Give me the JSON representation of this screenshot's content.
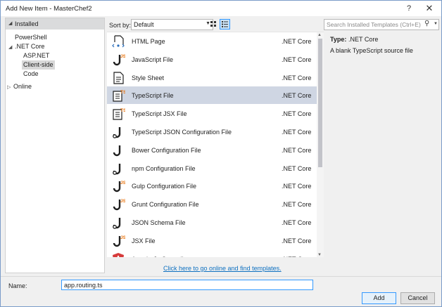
{
  "window": {
    "title": "Add New Item - MasterChef2",
    "help": "?",
    "close": "✕"
  },
  "tree": {
    "header": "Installed",
    "items": [
      {
        "label": "PowerShell",
        "expander": ""
      },
      {
        "label": ".NET Core",
        "expander": "◢"
      },
      {
        "label": "ASP.NET",
        "expander": ""
      },
      {
        "label": "Client-side",
        "expander": ""
      },
      {
        "label": "Code",
        "expander": ""
      },
      {
        "label": "Online",
        "expander": "▷"
      }
    ]
  },
  "toolbar": {
    "sort_label": "Sort by:",
    "sort_value": "Default"
  },
  "search": {
    "placeholder": "Search Installed Templates (Ctrl+E)"
  },
  "templates": [
    {
      "name": "HTML Page",
      "category": ".NET Core",
      "icon": "html-page-icon",
      "badge": ""
    },
    {
      "name": "JavaScript File",
      "category": ".NET Core",
      "icon": "javascript-file-icon",
      "badge": "JS"
    },
    {
      "name": "Style Sheet",
      "category": ".NET Core",
      "icon": "style-sheet-icon",
      "badge": ""
    },
    {
      "name": "TypeScript File",
      "category": ".NET Core",
      "icon": "typescript-file-icon",
      "badge": "TS"
    },
    {
      "name": "TypeScript JSX File",
      "category": ".NET Core",
      "icon": "typescript-jsx-file-icon",
      "badge": "TS"
    },
    {
      "name": "TypeScript JSON Configuration File",
      "category": ".NET Core",
      "icon": "json-config-file-icon",
      "badge": ""
    },
    {
      "name": "Bower Configuration File",
      "category": ".NET Core",
      "icon": "bower-config-file-icon",
      "badge": ""
    },
    {
      "name": "npm Configuration File",
      "category": ".NET Core",
      "icon": "npm-config-file-icon",
      "badge": ""
    },
    {
      "name": "Gulp Configuration File",
      "category": ".NET Core",
      "icon": "gulp-config-file-icon",
      "badge": "JS"
    },
    {
      "name": "Grunt Configuration File",
      "category": ".NET Core",
      "icon": "grunt-config-file-icon",
      "badge": "JS"
    },
    {
      "name": "JSON Schema File",
      "category": ".NET Core",
      "icon": "json-schema-file-icon",
      "badge": ""
    },
    {
      "name": "JSX File",
      "category": ".NET Core",
      "icon": "jsx-file-icon",
      "badge": "JS"
    },
    {
      "name": "AngularJs Controller",
      "category": ".NET Core",
      "icon": "angular-controller-icon",
      "badge": ""
    }
  ],
  "selected_template_index": 3,
  "info": {
    "type_label": "Type:",
    "type_value": ".NET Core",
    "description": "A blank TypeScript source file"
  },
  "online_link": "Click here to go online and find templates.",
  "name_field": {
    "label": "Name:",
    "value": "app.routing.ts"
  },
  "buttons": {
    "add": "Add",
    "cancel": "Cancel"
  },
  "colors": {
    "badge": "#e8720c",
    "icon": "#1e1e1e",
    "selection": "#cfd6e3",
    "link": "#0e70c0",
    "angular": "#d63b3b"
  }
}
